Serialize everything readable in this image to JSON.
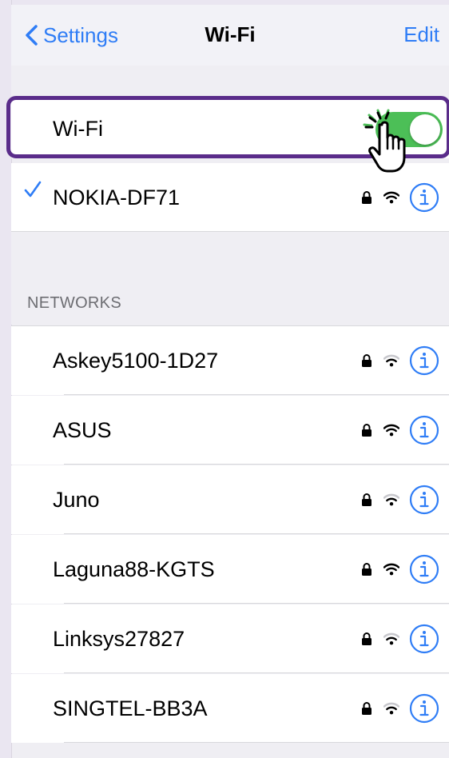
{
  "nav": {
    "back_label": "Settings",
    "title": "Wi-Fi",
    "edit_label": "Edit"
  },
  "wifi_toggle": {
    "label": "Wi-Fi",
    "on": true
  },
  "connected": {
    "name": "NOKIA-DF71",
    "secured": true,
    "signal": "full"
  },
  "networks_header": "NETWORKS",
  "networks": [
    {
      "name": "Askey5100-1D27",
      "secured": true,
      "signal": "low"
    },
    {
      "name": "ASUS",
      "secured": true,
      "signal": "full"
    },
    {
      "name": "Juno",
      "secured": true,
      "signal": "low"
    },
    {
      "name": "Laguna88-KGTS",
      "secured": true,
      "signal": "full"
    },
    {
      "name": "Linksys27827",
      "secured": true,
      "signal": "low"
    },
    {
      "name": "SINGTEL-BB3A",
      "secured": true,
      "signal": "low"
    }
  ],
  "colors": {
    "accent": "#2f7df6",
    "toggle_on": "#4cbf57",
    "highlight": "#5a2c8a"
  }
}
